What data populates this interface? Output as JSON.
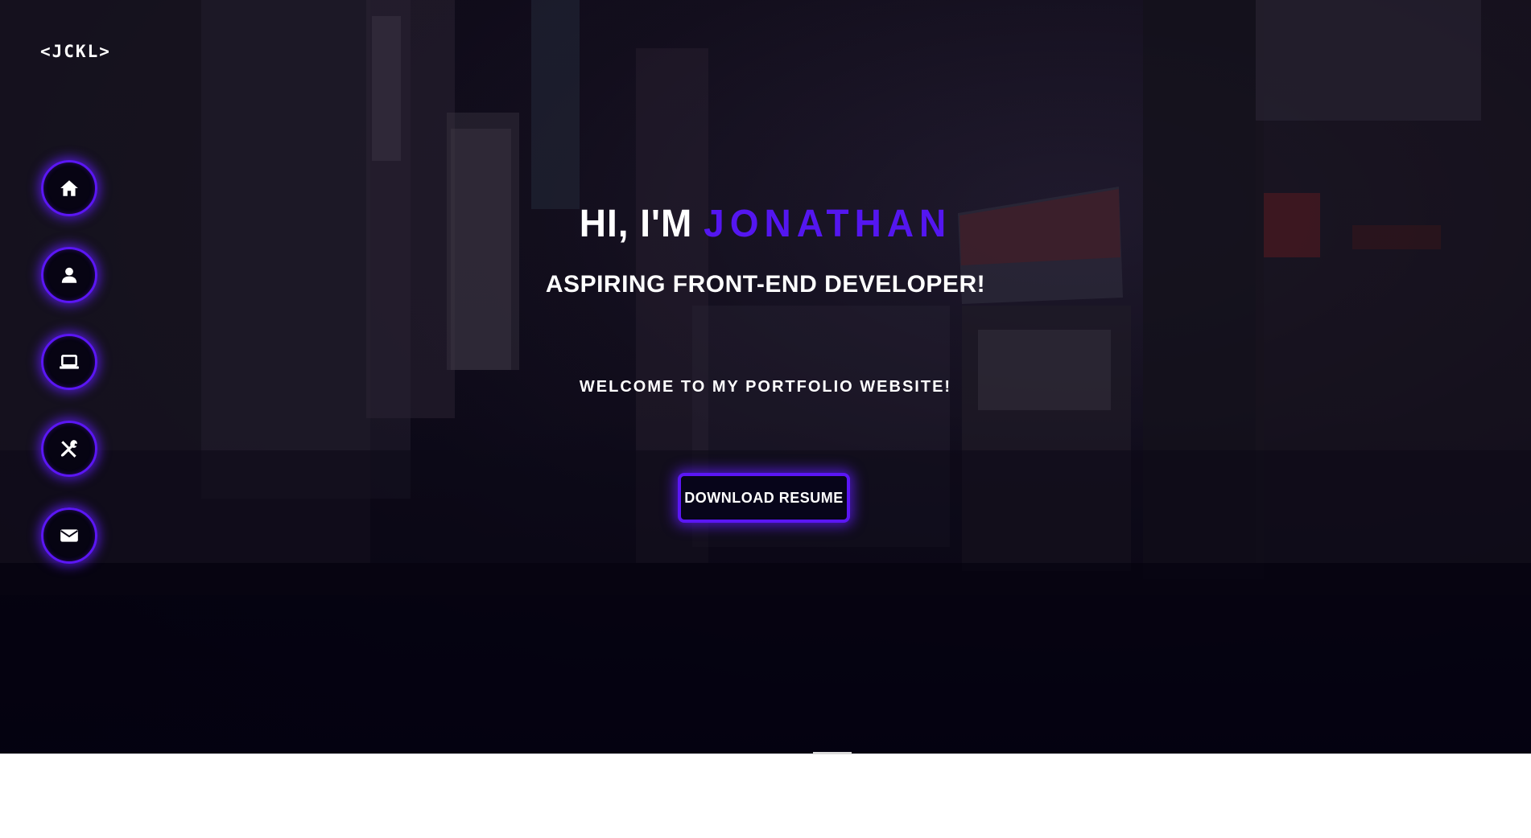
{
  "brand": {
    "logo_text": "<JCKL>"
  },
  "nav": {
    "items": [
      {
        "name": "home",
        "icon": "home-icon"
      },
      {
        "name": "about",
        "icon": "user-icon"
      },
      {
        "name": "projects",
        "icon": "laptop-icon"
      },
      {
        "name": "skills",
        "icon": "tools-icon"
      },
      {
        "name": "contact",
        "icon": "envelope-icon"
      }
    ]
  },
  "hero": {
    "greeting": "HI, I'M",
    "name": "JONATHAN",
    "subtitle": "ASPIRING FRONT-END DEVELOPER!",
    "welcome": "WELCOME TO MY PORTFOLIO WEBSITE!",
    "cta_label": "DOWNLOAD RESUME"
  },
  "colors": {
    "accent": "#5416f0",
    "glow": "#621eff",
    "text": "#ffffff",
    "background": "#06040d",
    "below_fold": "#ffffff"
  }
}
